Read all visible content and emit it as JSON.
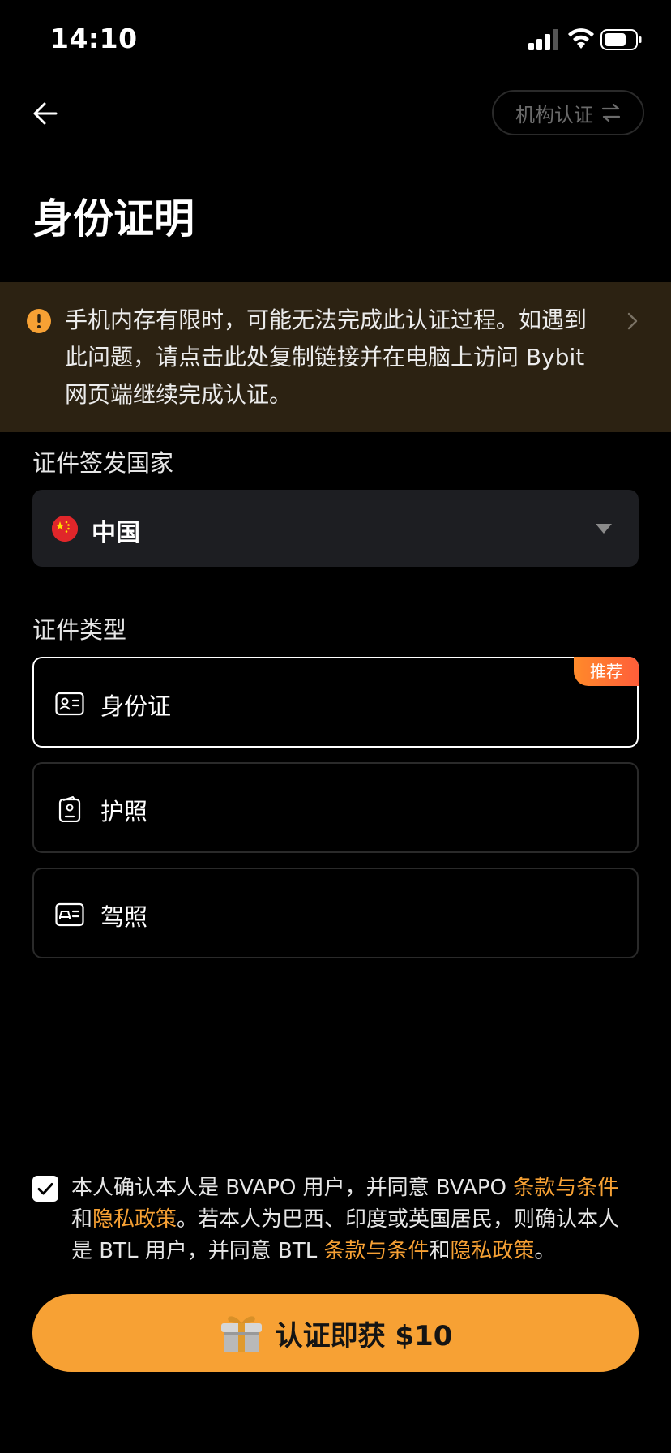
{
  "status_bar": {
    "time": "14:10"
  },
  "nav": {
    "org_button_label": "机构认证",
    "title": "身份证明"
  },
  "warning": {
    "text": "手机内存有限时，可能无法完成此认证过程。如遇到此问题，请点击此处复制链接并在电脑上访问 Bybit 网页端继续完成认证。"
  },
  "country_section": {
    "label": "证件签发国家",
    "selected_value": "中国"
  },
  "id_type_section": {
    "label": "证件类型",
    "options": [
      {
        "label": "身份证",
        "selected": true,
        "badge": "推荐",
        "icon": "id-card-icon"
      },
      {
        "label": "护照",
        "selected": false,
        "icon": "passport-icon"
      },
      {
        "label": "驾照",
        "selected": false,
        "icon": "driver-license-icon"
      }
    ]
  },
  "consent": {
    "checked": true,
    "part1": "本人确认本人是 BVAPO 用户，并同意 BVAPO ",
    "terms1": "条款与条件",
    "and1": "和",
    "privacy1": "隐私政策",
    "part2": "。若本人为巴西、印度或英国居民，则确认本人是 BTL 用户，并同意 BTL ",
    "terms2": "条款与条件",
    "and2": "和",
    "privacy2": "隐私政策",
    "end": "。"
  },
  "cta": {
    "label": "认证即获 $10"
  },
  "colors": {
    "accent": "#f7a134",
    "warning_bg": "#2c2212",
    "select_bg": "#1d1e22",
    "badge": "#ff6f33"
  }
}
